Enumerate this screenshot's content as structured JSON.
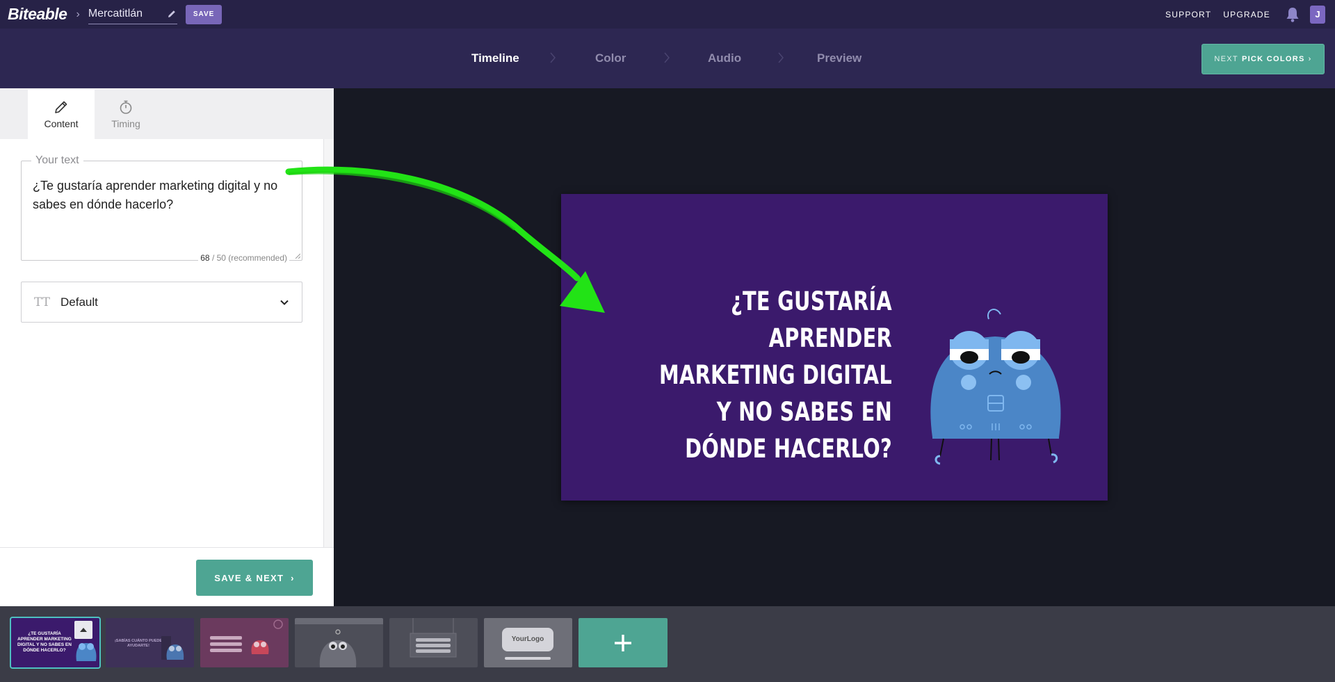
{
  "topbar": {
    "logo": "Biteable",
    "project_name": "Mercatitlán",
    "save_label": "SAVE",
    "support_label": "SUPPORT",
    "upgrade_label": "UPGRADE",
    "avatar_initial": "J"
  },
  "steps": {
    "items": [
      {
        "label": "Timeline",
        "active": true
      },
      {
        "label": "Color",
        "active": false
      },
      {
        "label": "Audio",
        "active": false
      },
      {
        "label": "Preview",
        "active": false
      }
    ],
    "next_prefix": "NEXT",
    "next_label": "PICK COLORS",
    "next_chevron": "›"
  },
  "panel": {
    "tabs": [
      {
        "label": "Content",
        "icon": "pencil-icon",
        "active": true
      },
      {
        "label": "Timing",
        "icon": "stopwatch-icon",
        "active": false
      }
    ],
    "text_field": {
      "legend": "Your text",
      "value": "¿Te gustaría aprender marketing digital y no sabes en dónde hacerlo?",
      "count": "68",
      "count_suffix": "/ 50 (recommended)"
    },
    "font_select": {
      "icon_glyph": "TT",
      "value": "Default"
    },
    "save_next_label": "SAVE & NEXT",
    "save_next_chevron": "›"
  },
  "slide": {
    "text": "¿TE GUSTARÍA APRENDER MARKETING DIGITAL Y NO SABES EN DÓNDE HACERLO?",
    "background": "#3b1a6c"
  },
  "filmstrip": {
    "thumb1_text": "¿TE GUSTARÍA APRENDER MARKETING DIGITAL Y NO SABES EN DÓNDE HACERLO?",
    "thumb2_text": "¡SABÍAS CUÁNTO PUEDE AYUDARTE!",
    "thumb6_text": "YourLogo",
    "add_label": "+"
  },
  "colors": {
    "topbar": "#272247",
    "stepsbar": "#2d2752",
    "accent": "#4ea593",
    "save_purple": "#7866b8",
    "annotation_green": "#22e316"
  }
}
